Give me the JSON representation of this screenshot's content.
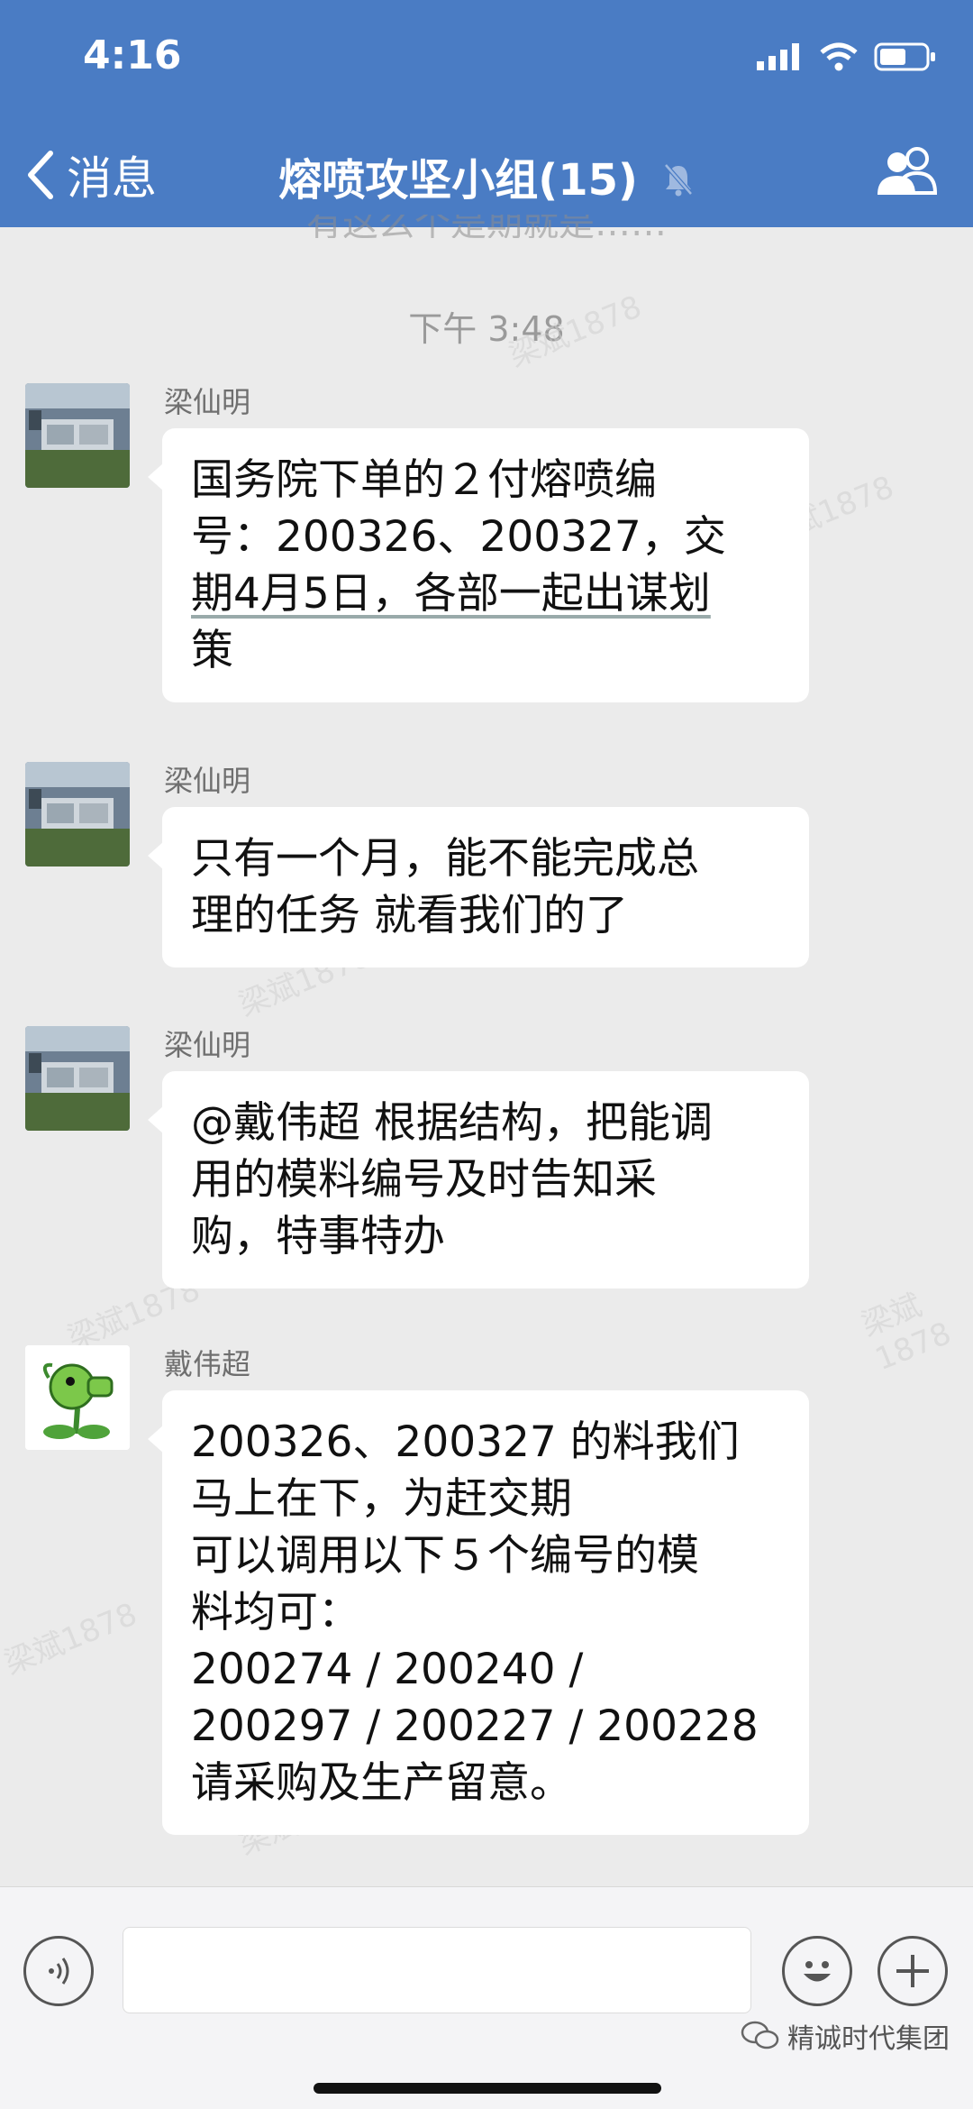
{
  "status": {
    "time": "4:16"
  },
  "nav": {
    "back_label": "消息",
    "title": "熔喷攻坚小组(15)"
  },
  "chat": {
    "peek_text": "有这么个是期就是……",
    "timestamp": "下午 3:48",
    "messages": [
      {
        "sender": "梁仙明",
        "lines": [
          "国务院下单的２付熔喷编",
          "号：200326、200327，交",
          "期4月5日，各部一起出谋划",
          "策"
        ]
      },
      {
        "sender": "梁仙明",
        "lines": [
          "只有一个月，能不能完成总",
          "理的任务 就看我们的了"
        ]
      },
      {
        "sender": "梁仙明",
        "lines": [
          "@戴伟超 根据结构，把能调",
          "用的模料编号及时告知采",
          "购，特事特办"
        ]
      },
      {
        "sender": "戴伟超",
        "lines": [
          "200326、200327 的料我们",
          "马上在下，为赶交期",
          "可以调用以下５个编号的模",
          "料均可：",
          "200274 / 200240 /",
          "200297 / 200227 / 200228",
          "请采购及生产留意。"
        ]
      }
    ]
  },
  "watermark": {
    "faint": "梁斌1878",
    "brand": "精诚时代集团"
  },
  "icons": {
    "back": "chevron-left-icon",
    "mute": "bell-slash-icon",
    "group": "group-members-icon",
    "voice": "voice-icon",
    "emoji": "emoji-icon",
    "add": "plus-icon"
  },
  "colors": {
    "header_bg": "#4a7cc4",
    "chat_bg": "#ebebeb",
    "bubble_bg": "#ffffff"
  }
}
